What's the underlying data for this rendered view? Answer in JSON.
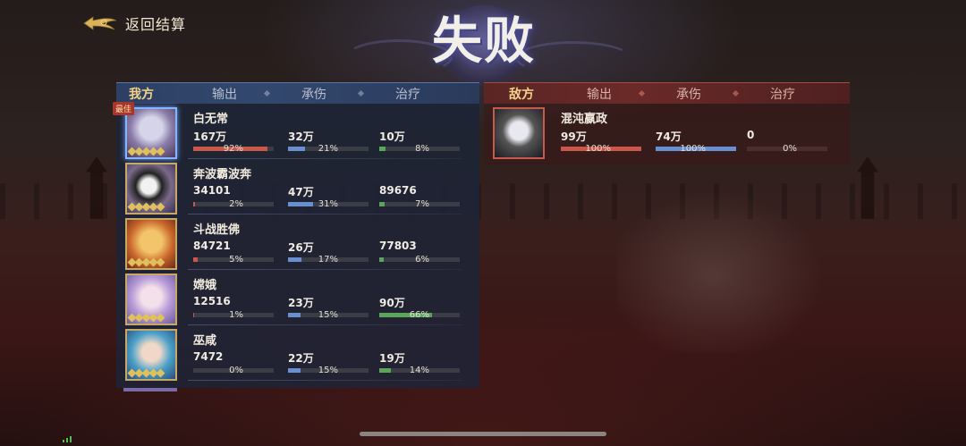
{
  "header": {
    "back_label": "返回结算",
    "result": "失败"
  },
  "ally": {
    "tabs": [
      "我方",
      "输出",
      "承伤",
      "治疗"
    ],
    "best_badge": "最佳",
    "heroes": [
      {
        "name": "白无常",
        "output": "167万",
        "output_pct": "92%",
        "output_fill": 0.92,
        "tank": "32万",
        "tank_pct": "21%",
        "tank_fill": 0.21,
        "heal": "10万",
        "heal_pct": "8%",
        "heal_fill": 0.08
      },
      {
        "name": "奔波霸波奔",
        "output": "34101",
        "output_pct": "2%",
        "output_fill": 0.02,
        "tank": "47万",
        "tank_pct": "31%",
        "tank_fill": 0.31,
        "heal": "89676",
        "heal_pct": "7%",
        "heal_fill": 0.07
      },
      {
        "name": "斗战胜佛",
        "output": "84721",
        "output_pct": "5%",
        "output_fill": 0.05,
        "tank": "26万",
        "tank_pct": "17%",
        "tank_fill": 0.17,
        "heal": "77803",
        "heal_pct": "6%",
        "heal_fill": 0.06
      },
      {
        "name": "嫦娥",
        "output": "12516",
        "output_pct": "1%",
        "output_fill": 0.01,
        "tank": "23万",
        "tank_pct": "15%",
        "tank_fill": 0.15,
        "heal": "90万",
        "heal_pct": "66%",
        "heal_fill": 0.66
      },
      {
        "name": "巫咸",
        "output": "7472",
        "output_pct": "0%",
        "output_fill": 0.0,
        "tank": "22万",
        "tank_pct": "15%",
        "tank_fill": 0.15,
        "heal": "19万",
        "heal_pct": "14%",
        "heal_fill": 0.14
      }
    ]
  },
  "enemy": {
    "tabs": [
      "敌方",
      "输出",
      "承伤",
      "治疗"
    ],
    "heroes": [
      {
        "name": "混沌嬴政",
        "output": "99万",
        "output_pct": "100%",
        "output_fill": 1.0,
        "tank": "74万",
        "tank_pct": "100%",
        "tank_fill": 1.0,
        "heal": "0",
        "heal_pct": "0%",
        "heal_fill": 0.0
      }
    ]
  },
  "colors": {
    "output": "#c9584a",
    "tank": "#6a8fd0",
    "heal": "#5aa55a",
    "accent": "#f5d48a"
  }
}
